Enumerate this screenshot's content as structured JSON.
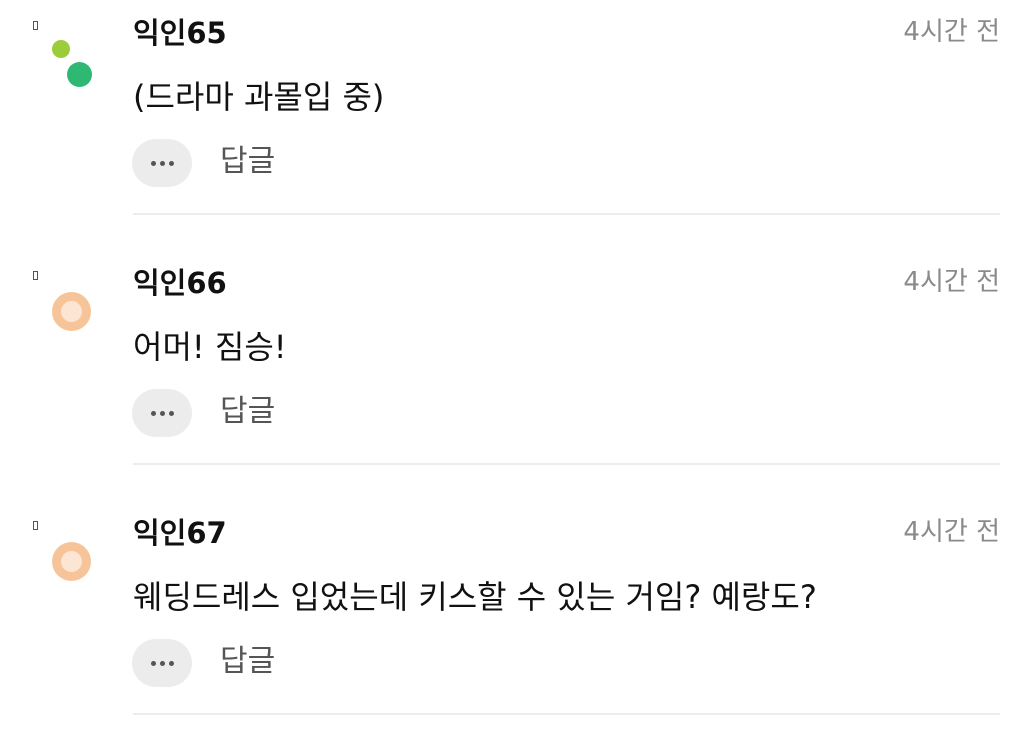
{
  "comments": [
    {
      "nickname": "익인65",
      "time": "4시간 전",
      "text": "(드라마 과몰입 중)",
      "reply_label": "답글",
      "more_label": "•••",
      "avatar": "green-dots-avatar"
    },
    {
      "nickname": "익인66",
      "time": "4시간 전",
      "text": "어머! 짐승!",
      "reply_label": "답글",
      "more_label": "•••",
      "avatar": "peach-ring-avatar"
    },
    {
      "nickname": "익인67",
      "time": "4시간 전",
      "text": "웨딩드레스 입었는데 키스할 수 있는 거임? 예랑도?",
      "reply_label": "답글",
      "more_label": "•••",
      "avatar": "peach-ring-avatar"
    }
  ],
  "colors": {
    "avatar_green_light": "#9ccc3a",
    "avatar_green_dark": "#2eb872",
    "avatar_peach": "#f7c49a",
    "avatar_peach_inner": "#fde5d4",
    "time_gray": "#8a8a8a",
    "divider": "#ececec"
  }
}
